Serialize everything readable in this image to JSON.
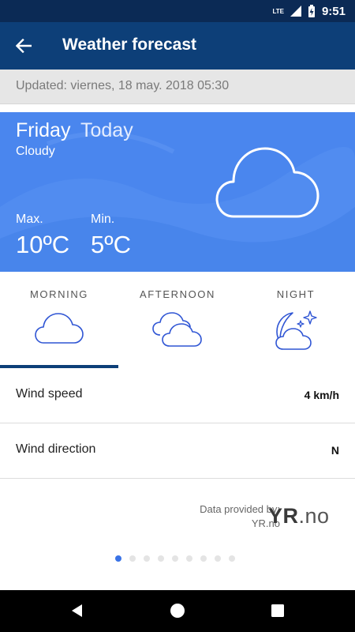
{
  "status_bar": {
    "time": "9:51",
    "network_label": "LTE",
    "battery_icon": "battery-charging-icon",
    "signal_icon": "signal-icon"
  },
  "app_bar": {
    "title": "Weather forecast",
    "back_icon": "arrow-back-icon"
  },
  "updated": {
    "text": "Updated: viernes, 18 may. 2018 05:30"
  },
  "forecast": {
    "day": "Friday",
    "relative_day": "Today",
    "condition": "Cloudy",
    "condition_icon": "cloud-icon",
    "max_label": "Max.",
    "max_value": "10ºC",
    "min_label": "Min.",
    "min_value": "5ºC",
    "hero_color": "#4a86ee"
  },
  "tabs": [
    {
      "label": "MORNING",
      "icon": "cloud-icon",
      "selected": true
    },
    {
      "label": "AFTERNOON",
      "icon": "clouds-icon",
      "selected": false
    },
    {
      "label": "NIGHT",
      "icon": "moon-stars-cloud-icon",
      "selected": false
    }
  ],
  "details": [
    {
      "label": "Wind speed",
      "value": "4 km/h"
    },
    {
      "label": "Wind direction",
      "value": "N"
    }
  ],
  "provider": {
    "label_line1": "Data provided by:",
    "label_line2": "YR.no",
    "logo_text_bold": "YR",
    "logo_text_rest": ".no"
  },
  "pager": {
    "total": 9,
    "active_index": 0
  },
  "nav_bar": {
    "back_icon": "nav-back-icon",
    "home_icon": "nav-home-icon",
    "recents_icon": "nav-recents-icon"
  },
  "colors": {
    "status_bar": "#0b2a55",
    "app_bar": "#0d3f78",
    "accent": "#3a73e6",
    "icon_stroke": "#2f55d4"
  }
}
